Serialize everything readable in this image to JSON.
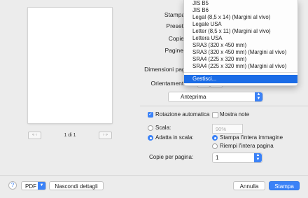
{
  "preview": {
    "page_indicator": "1 di 1"
  },
  "form": {
    "printer_label": "Stampante",
    "presets_label": "Preset",
    "copies_label": "Copie",
    "pages_label": "Pagine",
    "paper_size_label": "Dimensioni pagina",
    "orientation_label": "Orientamento"
  },
  "paper_menu": {
    "items": [
      "JIS B5",
      "JIS B6",
      "Legal (8,5 x 14) (Margini al vivo)",
      "Legale USA",
      "Letter (8,5 x 11) (Margini al vivo)",
      "Lettera USA",
      "SRA3 (320 x 450 mm)",
      "SRA3 (320 x 450 mm) (Margini al vivo)",
      "SRA4 (225 x 320 mm)",
      "SRA4 (225 x 320 mm) (Margini al vivo)"
    ],
    "highlighted": "Gestisci..."
  },
  "section_select": {
    "value": "Anteprima"
  },
  "options": {
    "auto_rotate": {
      "label": "Rotazione automatica",
      "checked": true
    },
    "show_notes": {
      "label": "Mostra note",
      "checked": false
    },
    "scale": {
      "label": "Scala:",
      "value": "90%"
    },
    "fit_scale": {
      "label": "Adatta in scala:"
    },
    "print_entire_image": {
      "label": "Stampa l'intera immagine"
    },
    "fill_entire_paper": {
      "label": "Riempi l'intera pagina"
    },
    "copies_per_page": {
      "label": "Copie per pagina:",
      "value": "1"
    }
  },
  "bottom": {
    "help": "?",
    "pdf": "PDF",
    "hide_details": "Nascondi dettagli",
    "cancel": "Annulla",
    "print": "Stampa"
  },
  "colors": {
    "accent": "#3b82f7",
    "highlight": "#1b6ce6"
  }
}
